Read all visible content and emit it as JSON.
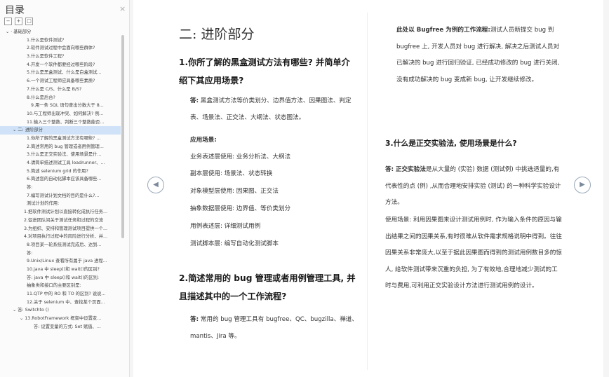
{
  "sidebar": {
    "title": "目录",
    "close": "×",
    "toc": [
      {
        "text": "⌄ · 基础部分",
        "indent": 8,
        "sel": false
      },
      {
        "text": "1.什么是软件测试?",
        "indent": 38,
        "sel": false
      },
      {
        "text": "2.软件测试过程中会面向哪些群体?",
        "indent": 38,
        "sel": false
      },
      {
        "text": "3.什么是软件工程?",
        "indent": 38,
        "sel": false
      },
      {
        "text": "4.开发一个软件都要经过哪些阶段?",
        "indent": 38,
        "sel": false
      },
      {
        "text": "5.什么是黑盒测试、什么是白盒测试...",
        "indent": 38,
        "sel": false
      },
      {
        "text": "6.一个测试工程师应具备哪些素质?",
        "indent": 38,
        "sel": false
      },
      {
        "text": "7.什么是 C/S、什么是 B/S?",
        "indent": 38,
        "sel": false
      },
      {
        "text": "8.什么是后台?",
        "indent": 38,
        "sel": false
      },
      {
        "text": "9.用一条 SQL 语句查出分数大于 8...",
        "indent": 44,
        "sel": false
      },
      {
        "text": "10.与工程师出现冲突、如何解决? 例...",
        "indent": 38,
        "sel": false
      },
      {
        "text": "11.输入三个整数、判断三个整数能否...",
        "indent": 38,
        "sel": false
      },
      {
        "text": "⌄ 二: 进阶部分",
        "indent": 18,
        "sel": true
      },
      {
        "text": "1.你所了解的黑盒测试方法有哪些? ...",
        "indent": 38,
        "sel": false
      },
      {
        "text": "2.简述常用的 bug 管理或者用例管理...",
        "indent": 38,
        "sel": false
      },
      {
        "text": "3.什么是正交实验法、使用场景是什...",
        "indent": 38,
        "sel": false
      },
      {
        "text": "4.请简单描述测试工具 loadrunner、...",
        "indent": 38,
        "sel": false
      },
      {
        "text": "5.简述 selenium grid 的作用?",
        "indent": 38,
        "sel": false
      },
      {
        "text": "6.简述您的自动化脚本应该具备哪些...",
        "indent": 38,
        "sel": false
      },
      {
        "text": "答:",
        "indent": 38,
        "sel": false
      },
      {
        "text": "7.编写测试计划文档的目的是什么?...",
        "indent": 38,
        "sel": false
      },
      {
        "text": "测试计划的作用:",
        "indent": 38,
        "sel": false
      },
      {
        "text": "1.把软件测试计划以直接转化成执行任务...",
        "indent": 34,
        "sel": false
      },
      {
        "text": "2.促进团队间关于测试任务和过程的交流",
        "indent": 34,
        "sel": false
      },
      {
        "text": "3.为组织、安排和管理测试项目提供一个...",
        "indent": 34,
        "sel": false
      },
      {
        "text": "4.对项目执行过程中的风险进行分析、并...",
        "indent": 34,
        "sel": false
      },
      {
        "text": "8.项目某一轮系统测试完成后、达到...",
        "indent": 38,
        "sel": false
      },
      {
        "text": "答:",
        "indent": 38,
        "sel": false
      },
      {
        "text": "9.Unix/Linux 查看所有属于 java 进程...",
        "indent": 38,
        "sel": false
      },
      {
        "text": "10.java 中 sleep()和 wait()的区别?",
        "indent": 38,
        "sel": false
      },
      {
        "text": "答: java 中 sleep()和 wait()的区别:",
        "indent": 38,
        "sel": false
      },
      {
        "text": "抽象类和接口的主要区别是:",
        "indent": 38,
        "sel": false
      },
      {
        "text": "11.QTP 中的 RO 和 TO 的区别? 说说...",
        "indent": 38,
        "sel": false
      },
      {
        "text": "12.关于 selenium 中、查找某个页面...",
        "indent": 38,
        "sel": false
      },
      {
        "text": "⌄ 答: Switchto ()",
        "indent": 18,
        "sel": false
      },
      {
        "text": "⌄ 13.RobotFramework 框架中设置变...",
        "indent": 28,
        "sel": false
      },
      {
        "text": "答: 设置变量的方式: Set 赋值、...",
        "indent": 48,
        "sel": false
      }
    ]
  },
  "nav": {
    "prev": "◀",
    "next": "▶"
  },
  "left_page": {
    "heading": "二:  进阶部分",
    "q1": "1.你所了解的黑盒测试方法有哪些? 并简单介绍下其应用场景?",
    "q1_answer_label": "答:",
    "q1_answer": "黑盒测试方法等价类划分、边界值方法、因果图法、判定表、场景法、正交法、大纲法、状态图法。",
    "q1_scene_title": "应用场景:",
    "q1_lines": [
      "业务表述层使用: 业务分析法、大纲法",
      "副本层使用: 场景法、状态转换",
      "对象模型层使用: 因果图、正交法",
      "抽象数据层使用: 边界值、等价类划分",
      "用例表述层: 详细测试用例",
      "测试脚本层: 编写自动化测试脚本"
    ],
    "q2": "2.简述常用的 bug 管理或者用例管理工具, 并且描述其中的一个工作流程?",
    "q2_answer_label": "答:",
    "q2_answer": "常用的 bug 管理工具有 bugfree、QC、bugzilla、禅道、mantis、Jira 等。"
  },
  "right_page": {
    "flow_label": "此处以 Bugfree 为例的工作流程:",
    "flow_text": "测试人员新提交 bug 到 bugfree 上, 开发人员对 bug 进行解决, 解决之后测试人员对已解决的 bug 进行回归验证, 已经成功修改的 bug 进行关闭, 没有成功解决的 bug 变成新 bug, 让开发继续修改。",
    "q3": "3.什么是正交实验法, 使用场景是什么?",
    "q3_answer_label": "答: 正交实验法",
    "q3_answer": "是从大量的 (实验) 数据 (测试例) 中挑选适量的,有代表性的点 (例) ,从而合理地安排实验 (测试) 的一种科学实验设计方法。",
    "q3_scene": "使用场景: 利用因果图来设计测试用例时, 作为输入条件的原因与输出结果之间的因果关系,有时很难从软件需求规格说明中得到。往往因果关系非常庞大,以至于据此因果图而得到的测试用例数目多的惊人, 给软件测试带来沉重的负担, 为了有效地,合理地减少测试的工时与费用,可利用正交实验设计方法进行测试用例的设计。"
  }
}
